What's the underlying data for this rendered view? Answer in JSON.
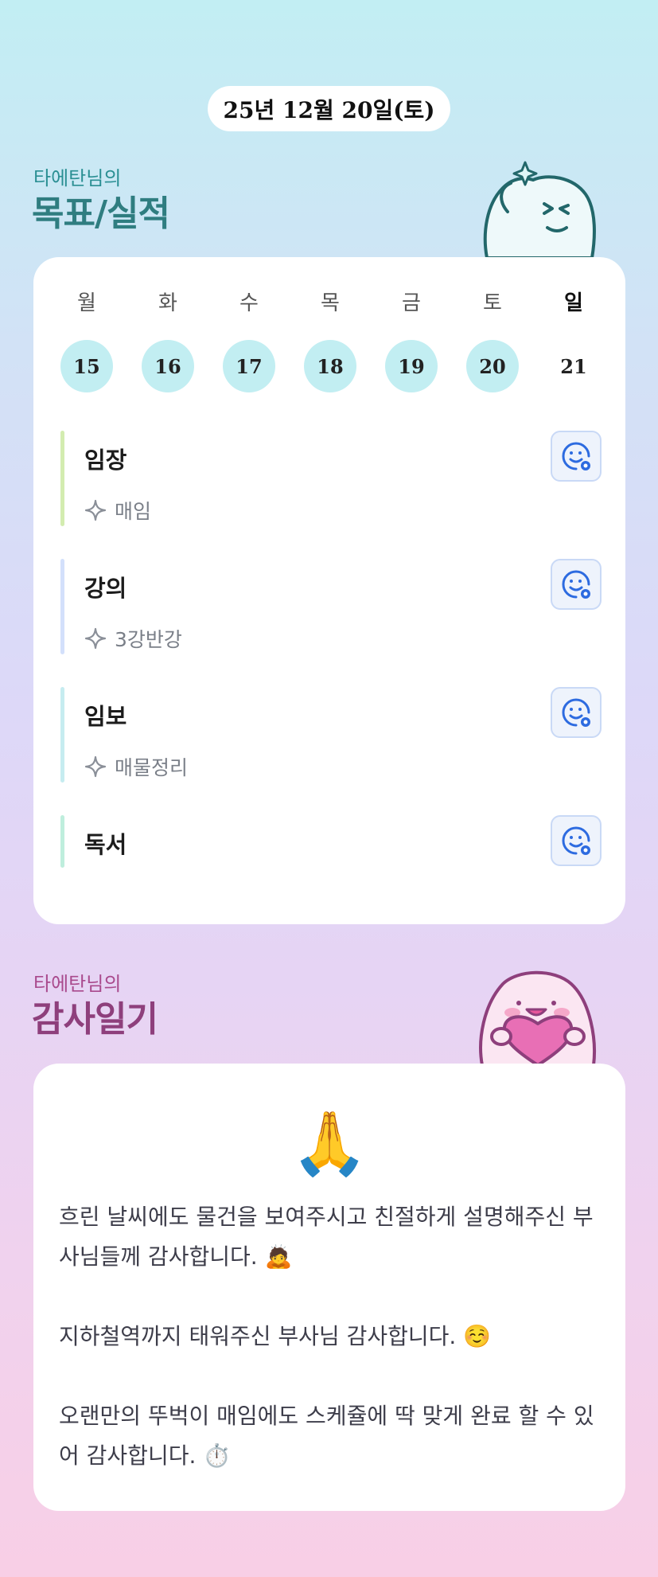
{
  "header": {
    "date": "25년 12월 20일(토)"
  },
  "goals_section": {
    "subtitle": "타에탄님의",
    "title": "목표/실적",
    "week": [
      {
        "label": "월",
        "num": "15",
        "done": true
      },
      {
        "label": "화",
        "num": "16",
        "done": true
      },
      {
        "label": "수",
        "num": "17",
        "done": true
      },
      {
        "label": "목",
        "num": "18",
        "done": true
      },
      {
        "label": "금",
        "num": "19",
        "done": true
      },
      {
        "label": "토",
        "num": "20",
        "done": true
      },
      {
        "label": "일",
        "num": "21",
        "done": false
      }
    ],
    "items": [
      {
        "name": "임장",
        "detail": "매임",
        "bar_color": "#d3ecb0"
      },
      {
        "name": "강의",
        "detail": "3강반강",
        "bar_color": "#d3e0fb"
      },
      {
        "name": "임보",
        "detail": "매물정리",
        "bar_color": "#c6ecf0"
      },
      {
        "name": "독서",
        "detail": "",
        "bar_color": "#bfeedd"
      }
    ]
  },
  "thanks_section": {
    "subtitle": "타에탄님의",
    "title": "감사일기",
    "emoji": "🙏",
    "paragraphs": [
      "흐린 날씨에도 물건을 보여주시고 친절하게 설명해주신 부사님들께 감사합니다. 🙇",
      "지하철역까지 태워주신 부사님 감사합니다. ☺️",
      "오랜만의 뚜벅이 매임에도 스케쥴에 딱 맞게 완료 할 수 있어 감사합니다. ⏱️"
    ]
  },
  "colors": {
    "goal_title": "#2f7d80",
    "thanks_title": "#8e3f7c",
    "day_done": "#c2eef2",
    "button_accent": "#2d6be0"
  }
}
